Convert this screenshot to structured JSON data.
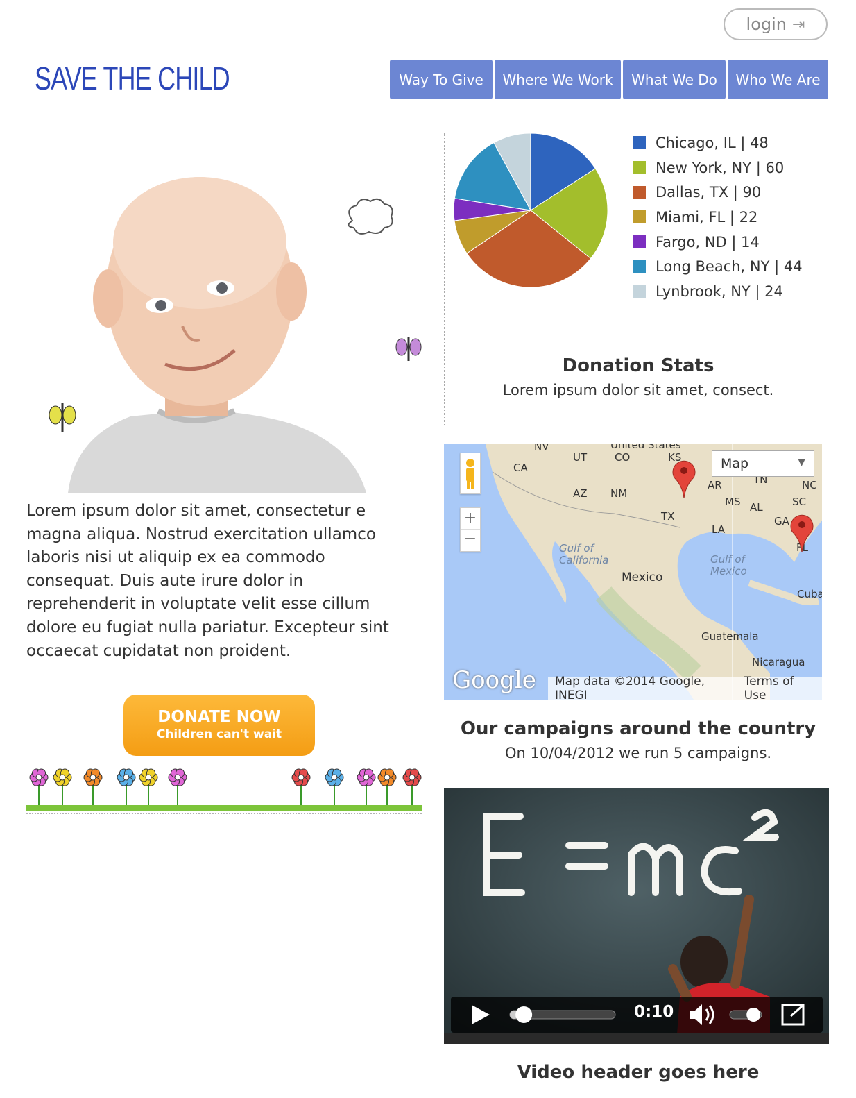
{
  "header": {
    "login_label": "login",
    "logo_text": "SAVE THE CHILD",
    "nav": [
      "Way To Give",
      "Where We Work",
      "What We Do",
      "Who We Are"
    ]
  },
  "main": {
    "lorem": "Lorem ipsum dolor sit amet, consectetur e magna aliqua. Nostrud exercitation ullamco laboris nisi ut aliquip ex ea commodo consequat. Duis aute irure dolor in reprehenderit in voluptate velit esse cillum dolore eu fugiat nulla pariatur. Excepteur sint occaecat cupidatat non proident.",
    "donate_label": "DONATE NOW",
    "donate_sub": "Children can't wait"
  },
  "stats": {
    "title": "Donation Stats",
    "subtitle": "Lorem ipsum dolor sit amet, consect.",
    "legend": [
      {
        "label": "Chicago, IL | 48",
        "color": "#2e64be"
      },
      {
        "label": "New York, NY | 60",
        "color": "#a3be2c"
      },
      {
        "label": "Dallas, TX | 90",
        "color": "#c05a2c"
      },
      {
        "label": "Miami, FL | 22",
        "color": "#c09c2c"
      },
      {
        "label": "Fargo, ND | 14",
        "color": "#7c2ec0"
      },
      {
        "label": "Long Beach, NY | 44",
        "color": "#2e90c0"
      },
      {
        "label": "Lynbrook, NY | 24",
        "color": "#c4d4dc"
      }
    ]
  },
  "chart_data": {
    "type": "pie",
    "categories": [
      "Chicago, IL",
      "New York, NY",
      "Dallas, TX",
      "Miami, FL",
      "Fargo, ND",
      "Long Beach, NY",
      "Lynbrook, NY"
    ],
    "values": [
      48,
      60,
      90,
      22,
      14,
      44,
      24
    ],
    "colors": [
      "#2e64be",
      "#a3be2c",
      "#c05a2c",
      "#c09c2c",
      "#7c2ec0",
      "#2e90c0",
      "#c4d4dc"
    ],
    "legend": "right"
  },
  "map": {
    "type_select": "Map",
    "attribution": "Map data ©2014 Google, INEGI",
    "terms": "Terms of Use",
    "brand": "Google",
    "labels": [
      "United States",
      "NV",
      "UT",
      "CO",
      "KS",
      "CA",
      "AZ",
      "NM",
      "TX",
      "AR",
      "TN",
      "NC",
      "MS",
      "AL",
      "SC",
      "GA",
      "LA",
      "FL",
      "Gulf of California",
      "Mexico",
      "Gulf of Mexico",
      "Cuba",
      "Guatemala",
      "Nicaragua"
    ]
  },
  "campaigns": {
    "title": "Our campaigns around the country",
    "subtitle": "On 10/04/2012 we run 5 campaigns."
  },
  "video": {
    "time": "0:10",
    "progress": 0.08,
    "volume": 0.7,
    "title": "Video header goes here"
  }
}
